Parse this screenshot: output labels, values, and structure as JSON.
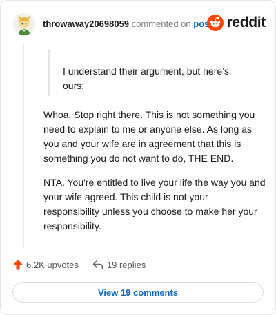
{
  "comment": {
    "author": "throwaway20698059",
    "action_text": "commented on",
    "post_link_label": "post",
    "quote": "I understand their argument, but here’s ours:",
    "paragraphs": [
      "Whoa. Stop right there. This is not something you need to explain to me or anyone else. As long as you and your wife are in agreement that this is something you do not want to do, THE END.",
      "NTA. You're entitled to live your life the way you and your wife agreed. This child is not your responsibility unless you choose to make her your responsibility."
    ]
  },
  "brand": {
    "name": "reddit",
    "color": "#ff4500"
  },
  "stats": {
    "upvotes": "6.2K upvotes",
    "replies": "19 replies"
  },
  "view_comments_label": "View 19 comments",
  "icons": {
    "avatar": "avatar-icon",
    "logo": "reddit-logo-icon",
    "upvote": "upvote-arrow-icon",
    "reply": "reply-arrow-icon"
  },
  "colors": {
    "link": "#0a66c2",
    "upvote": "#ff4500"
  }
}
